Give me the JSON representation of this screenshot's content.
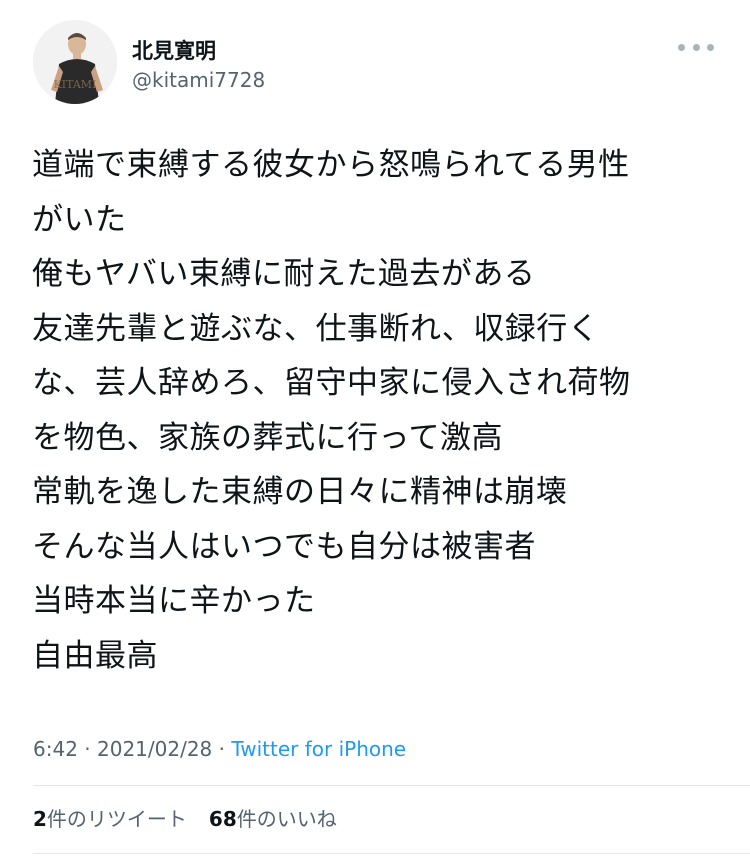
{
  "user": {
    "display_name": "北見寛明",
    "handle": "@kitami7728",
    "avatar_text": "KITAMI"
  },
  "tweet": {
    "lines": [
      "道端で束縛する彼女から怒鳴られてる男性",
      "がいた",
      "俺もヤバい束縛に耐えた過去がある",
      "友達先輩と遊ぶな、仕事断れ、収録行く",
      "な、芸人辞めろ、留守中家に侵入され荷物",
      "を物色、家族の葬式に行って激高",
      "常軌を逸した束縛の日々に精神は崩壊",
      "そんな当人はいつでも自分は被害者",
      "当時本当に辛かった",
      "自由最高"
    ]
  },
  "meta": {
    "time": "6:42",
    "sep1": " · ",
    "date": "2021/02/28",
    "sep2": " · ",
    "source": "Twitter for iPhone"
  },
  "stats": {
    "retweets_count": "2",
    "retweets_label": "件のリツイート",
    "likes_count": "68",
    "likes_label": "件のいいね"
  },
  "icons": {
    "more": "more-horizontal-icon"
  }
}
